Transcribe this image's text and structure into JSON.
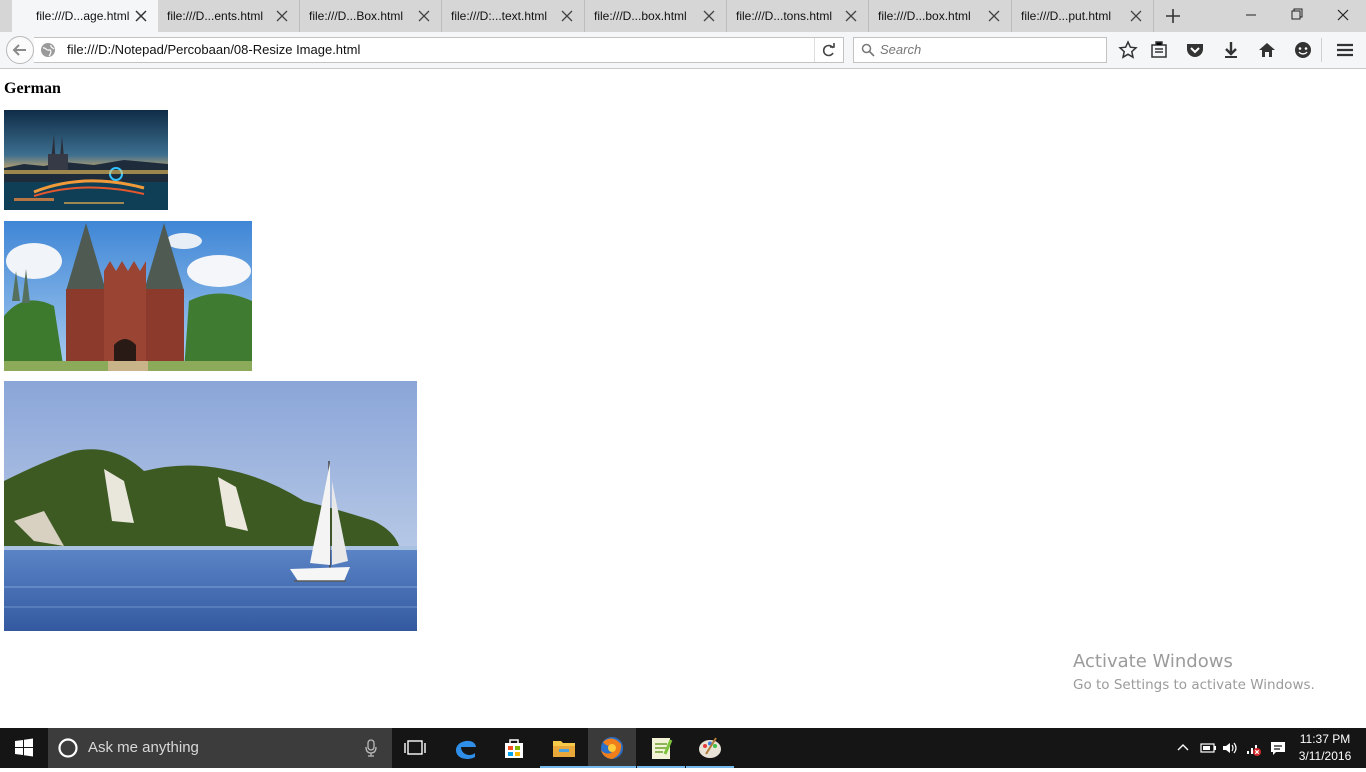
{
  "browser": {
    "tabs": [
      {
        "label": "file:///D...age.html",
        "active": true
      },
      {
        "label": "file:///D...ents.html",
        "active": false
      },
      {
        "label": "file:///D...Box.html",
        "active": false
      },
      {
        "label": "file:///D:...text.html",
        "active": false
      },
      {
        "label": "file:///D...box.html",
        "active": false
      },
      {
        "label": "file:///D...tons.html",
        "active": false
      },
      {
        "label": "file:///D...box.html",
        "active": false
      },
      {
        "label": "file:///D...put.html",
        "active": false
      }
    ],
    "url": "file:///D:/Notepad/Percobaan/08-Resize Image.html",
    "search_placeholder": "Search"
  },
  "page": {
    "heading": "German",
    "images": [
      {
        "subject": "cologne-night-skyline"
      },
      {
        "subject": "holstentor-gate"
      },
      {
        "subject": "chalk-cliffs-sailboat"
      }
    ]
  },
  "watermark": {
    "title": "Activate Windows",
    "subtitle": "Go to Settings to activate Windows."
  },
  "taskbar": {
    "search_placeholder": "Ask me anything",
    "time": "11:37 PM",
    "date": "3/11/2016",
    "active_app": "firefox"
  },
  "colors": {
    "tab_strip": "#d6d6d6",
    "toolbar": "#f5f6f7",
    "taskbar": "#151515",
    "accent": "#76b9ed"
  }
}
